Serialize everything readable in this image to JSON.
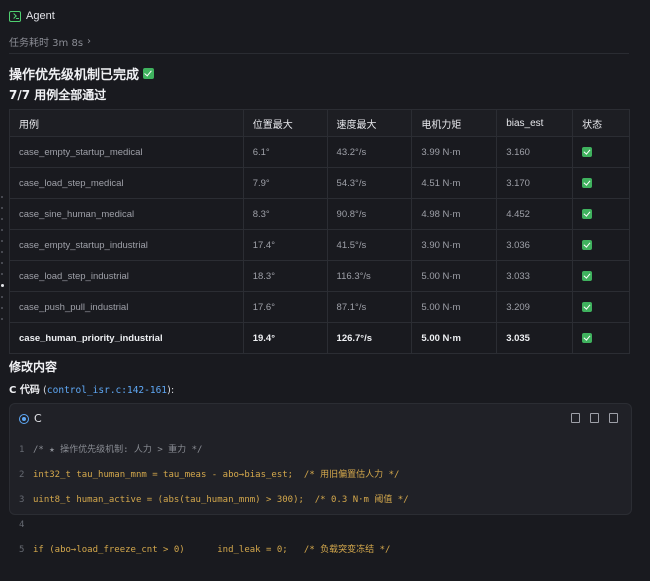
{
  "header": {
    "title": "Agent",
    "elapsed": "任务耗时 3m 8s"
  },
  "heading1": "操作优先级机制已完成",
  "heading2": "7/7 用例全部通过",
  "table": {
    "columns": [
      "用例",
      "位置最大",
      "速度最大",
      "电机力矩",
      "bias_est",
      "状态"
    ],
    "rows": [
      [
        "case_empty_startup_medical",
        "6.1°",
        "43.2°/s",
        "3.99 N·m",
        "3.160"
      ],
      [
        "case_load_step_medical",
        "7.9°",
        "54.3°/s",
        "4.51 N·m",
        "3.170"
      ],
      [
        "case_sine_human_medical",
        "8.3°",
        "90.8°/s",
        "4.98 N·m",
        "4.452"
      ],
      [
        "case_empty_startup_industrial",
        "17.4°",
        "41.5°/s",
        "3.90 N·m",
        "3.036"
      ],
      [
        "case_load_step_industrial",
        "18.3°",
        "116.3°/s",
        "5.00 N·m",
        "3.033"
      ],
      [
        "case_push_pull_industrial",
        "17.6°",
        "87.1°/s",
        "5.00 N·m",
        "3.209"
      ],
      [
        "case_human_priority_industrial",
        "19.4°",
        "126.7°/s",
        "5.00 N·m",
        "3.035"
      ]
    ]
  },
  "heading3": "修改内容",
  "code_ref": {
    "label": "C 代码",
    "file": "control_isr.c:142-161",
    "suffix": "):"
  },
  "code_block": {
    "language": "C",
    "lines": [
      {
        "n": "1",
        "text": "/* ★ 操作优先级机制: 人力 > 重力 */"
      },
      {
        "n": "2",
        "text": "int32_t tau_human_mnm = tau_meas - abo→bias_est;  /* 用旧偏置估人力 */"
      },
      {
        "n": "3",
        "text": "uint8_t human_active = (abs(tau_human_mnm) > 300);  /* 0.3 N·m 阈值 */"
      },
      {
        "n": "4",
        "text": ""
      },
      {
        "n": "5",
        "text": "if (abo→load_freeze_cnt > 0)      ind_leak = 0;   /* 负载突变冻结 */"
      }
    ]
  },
  "colors": {
    "background": "#191a1f",
    "accent": "#5fa8f5",
    "success": "#3fb25e"
  }
}
